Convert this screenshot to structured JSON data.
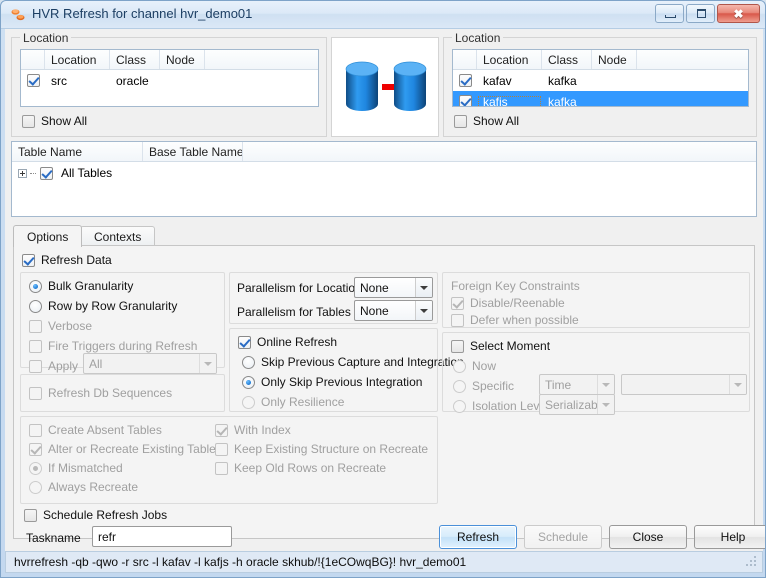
{
  "window": {
    "title": "HVR Refresh for channel hvr_demo01",
    "icon": "hvr-refresh-icon",
    "minimize_label": "Minimize",
    "maximize_label": "Maximize",
    "close_label": "Close"
  },
  "source_panel": {
    "legend": "Location",
    "columns": [
      "",
      "Location",
      "Class",
      "Node"
    ],
    "rows": [
      {
        "checked": true,
        "location": "src",
        "class": "oracle",
        "node": ""
      }
    ],
    "show_all_label": "Show All",
    "show_all_checked": false
  },
  "graphic": {
    "name": "database-to-database-arrow",
    "source_db": "source-database-cylinder",
    "target_db": "target-database-cylinder",
    "arrow_color": "#ee0000",
    "db_color": "#1f86e0"
  },
  "target_panel": {
    "legend": "Location",
    "columns": [
      "",
      "Location",
      "Class",
      "Node"
    ],
    "rows": [
      {
        "checked": true,
        "location": "kafav",
        "class": "kafka",
        "node": "",
        "selected": false
      },
      {
        "checked": true,
        "location": "kafjs",
        "class": "kafka",
        "node": "",
        "selected": true
      }
    ],
    "show_all_label": "Show All",
    "show_all_checked": false
  },
  "tables_panel": {
    "columns": [
      "Table Name",
      "Base Table Name",
      ""
    ],
    "rows": [
      {
        "label": "All Tables",
        "checked": true,
        "expandable": true
      }
    ]
  },
  "tabs": [
    {
      "label": "Options",
      "active": true
    },
    {
      "label": "Contexts",
      "active": false
    }
  ],
  "options": {
    "refresh_data": {
      "label": "Refresh Data",
      "checked": true,
      "enabled": true
    },
    "granularity_group": {
      "bulk": {
        "label": "Bulk Granularity",
        "selected": true,
        "enabled": true
      },
      "row_by_row": {
        "label": "Row by Row Granularity",
        "selected": false,
        "enabled": true
      },
      "verbose": {
        "label": "Verbose",
        "checked": false,
        "enabled": false
      },
      "fire_triggers": {
        "label": "Fire Triggers during Refresh",
        "checked": false,
        "enabled": false
      },
      "apply": {
        "label": "Apply",
        "checked": false,
        "enabled": false,
        "value": "All"
      }
    },
    "refresh_db_sequences": {
      "label": "Refresh Db Sequences",
      "checked": false,
      "enabled": false
    },
    "parallelism": {
      "locations_label": "Parallelism for Locations",
      "locations_value": "None",
      "tables_label": "Parallelism for Tables",
      "tables_value": "None"
    },
    "online_refresh": {
      "label": "Online Refresh",
      "checked": true,
      "enabled": true,
      "skip_previous_capture": {
        "label": "Skip Previous Capture and Integration",
        "selected": false,
        "enabled": true
      },
      "only_skip_previous": {
        "label": "Only Skip Previous Integration",
        "selected": true,
        "enabled": true
      },
      "only_resilience": {
        "label": "Only Resilience",
        "selected": false,
        "enabled": false
      }
    },
    "foreign_key": {
      "label": "Foreign Key Constraints",
      "enabled": false,
      "disable_reenable": {
        "label": "Disable/Reenable",
        "checked": true,
        "enabled": false
      },
      "defer_when_possible": {
        "label": "Defer when possible",
        "checked": false,
        "enabled": false
      }
    },
    "select_moment": {
      "label": "Select Moment",
      "checked": false,
      "enabled": true,
      "now": {
        "label": "Now",
        "selected": false,
        "enabled": false
      },
      "specific": {
        "label": "Specific",
        "selected": false,
        "enabled": false,
        "type_value": "Time",
        "detail_value": ""
      },
      "isolation_level": {
        "label": "Isolation Level",
        "selected": false,
        "enabled": false,
        "value": "Serializable"
      }
    },
    "tables_section": {
      "create_absent_tables": {
        "label": "Create Absent Tables",
        "checked": false,
        "enabled": false
      },
      "alter_or_recreate": {
        "label": "Alter or Recreate Existing Tables",
        "checked": true,
        "enabled": false
      },
      "if_mismatched": {
        "label": "If Mismatched",
        "selected": true,
        "enabled": false
      },
      "always_recreate": {
        "label": "Always Recreate",
        "selected": false,
        "enabled": false
      },
      "with_index": {
        "label": "With Index",
        "checked": true,
        "enabled": false
      },
      "keep_existing_structure": {
        "label": "Keep Existing Structure on Recreate",
        "checked": false,
        "enabled": false
      },
      "keep_old_rows": {
        "label": "Keep Old Rows on Recreate",
        "checked": false,
        "enabled": false
      }
    },
    "schedule": {
      "label": "Schedule Refresh Jobs",
      "checked": false,
      "enabled": true,
      "taskname_label": "Taskname",
      "taskname_value": "refr"
    }
  },
  "buttons": {
    "refresh": {
      "label": "Refresh",
      "default": true,
      "enabled": true
    },
    "schedule": {
      "label": "Schedule",
      "enabled": false
    },
    "close": {
      "label": "Close",
      "enabled": true
    },
    "help": {
      "label": "Help",
      "enabled": true
    }
  },
  "statusbar": {
    "command": "hvrrefresh -qb -qwo -r src -l kafav -l kafjs -h oracle skhub/!{1eCOwqBG}! hvr_demo01"
  }
}
